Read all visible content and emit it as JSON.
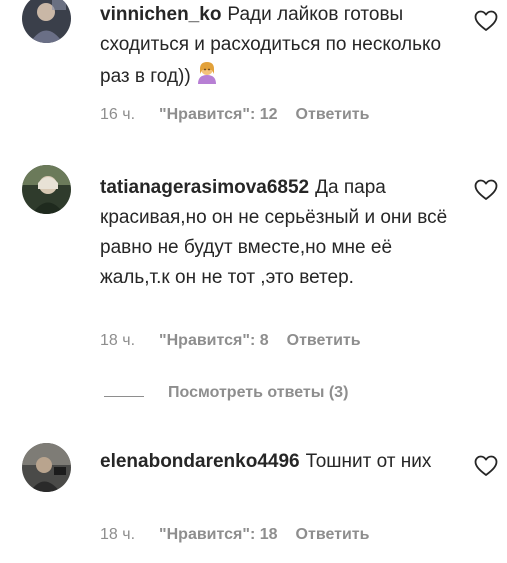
{
  "comments": [
    {
      "username": "vinnichen_ko",
      "text": "Ради лайков готовы сходиться и расходиться по несколько раз в год))",
      "emoji": "woman-gesturing-icon",
      "time": "16 ч.",
      "likes": "\"Нравится\": 12",
      "reply": "Ответить"
    },
    {
      "username": "tatianagerasimova6852",
      "text": "Да пара красивая,но он не серьёзный и они всё равно не будут вместе,но мне её жаль,т.к он не тот ,это ветер.",
      "time": "18 ч.",
      "likes": "\"Нравится\": 8",
      "reply": "Ответить"
    },
    {
      "username": "elenabondarenko4496",
      "text": "Тошнит от них",
      "time": "18 ч.",
      "likes": "\"Нравится\": 18",
      "reply": "Ответить"
    }
  ],
  "replies_toggle": "Посмотреть ответы (3)",
  "colors": {
    "text": "#262626",
    "muted": "#8e8e8e",
    "background": "#ffffff"
  }
}
